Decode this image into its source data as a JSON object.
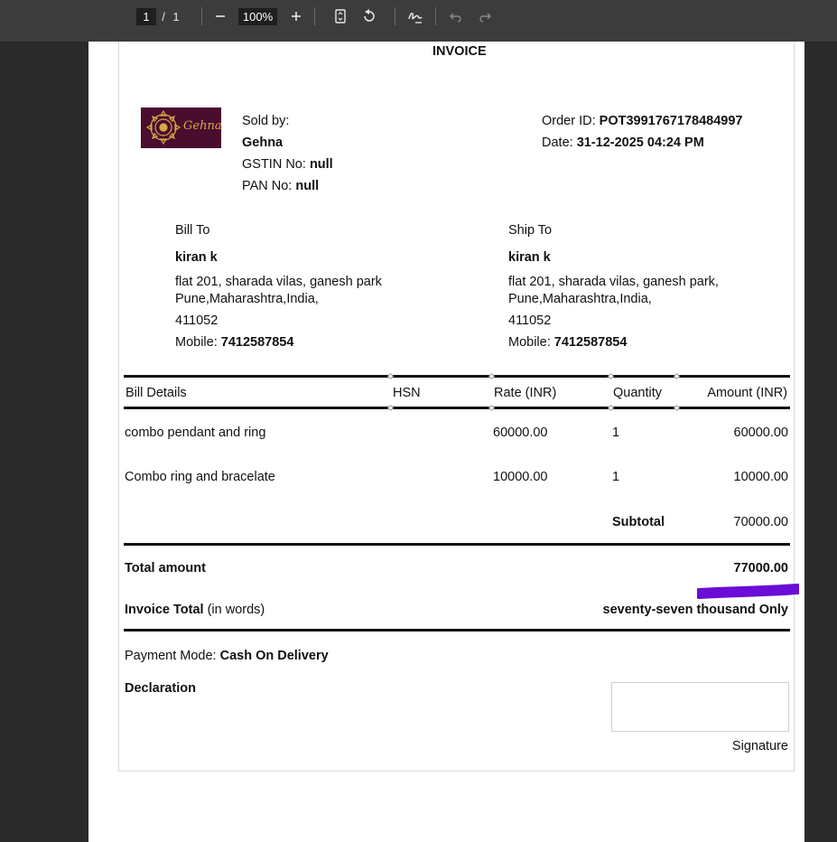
{
  "toolbar": {
    "page_current": "1",
    "page_sep": "/",
    "page_total": "1",
    "zoom": "100%"
  },
  "invoice": {
    "title": "INVOICE",
    "logo_text": "Gehna",
    "seller": {
      "sold_by_label": "Sold by:",
      "name": "Gehna",
      "gstin_label": "GSTIN No:",
      "gstin_value": "null",
      "pan_label": "PAN No:",
      "pan_value": "null"
    },
    "order": {
      "order_id_label": "Order ID:",
      "order_id_value": "POT3991767178484997",
      "date_label": "Date:",
      "date_value": "31-12-2025 04:24 PM"
    },
    "bill_to": {
      "heading": "Bill To",
      "name": "kiran k",
      "address_line1": "flat 201, sharada vilas, ganesh park",
      "address_line2": "Pune,Maharashtra,India,",
      "pincode": "411052",
      "mobile_label": "Mobile:",
      "mobile_value": "7412587854"
    },
    "ship_to": {
      "heading": "Ship To",
      "name": "kiran k",
      "address_line1": "flat 201, sharada vilas, ganesh park,",
      "address_line2": "Pune,Maharashtra,India,",
      "pincode": "411052",
      "mobile_label": "Mobile:",
      "mobile_value": "7412587854"
    },
    "table": {
      "headers": [
        "Bill Details",
        "HSN",
        "Rate (INR)",
        "Quantity",
        "Amount (INR)"
      ],
      "rows": [
        {
          "details": "combo pendant and ring",
          "hsn": "",
          "rate": "60000.00",
          "quantity": "1",
          "amount": "60000.00"
        },
        {
          "details": "Combo ring and bracelate",
          "hsn": "",
          "rate": "10000.00",
          "quantity": "1",
          "amount": "10000.00"
        }
      ],
      "subtotal_label": "Subtotal",
      "subtotal_value": "70000.00"
    },
    "total": {
      "label": "Total amount",
      "value": "77000.00",
      "words_label": "Invoice Total",
      "words_suffix": "(in words)",
      "words_value": "seventy-seven thousand Only"
    },
    "payment": {
      "label": "Payment Mode:",
      "value": "Cash On Delivery"
    },
    "declaration_label": "Declaration",
    "signature_label": "Signature",
    "highlight_color": "#6a0dd6"
  }
}
